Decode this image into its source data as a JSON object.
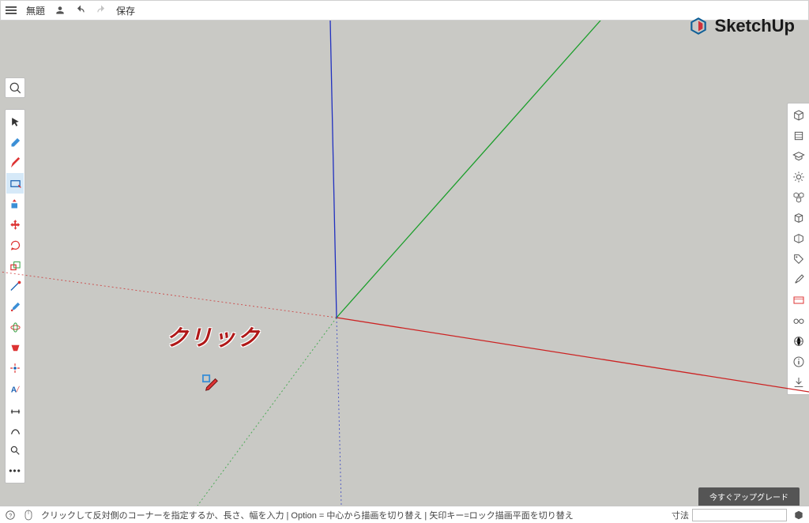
{
  "topbar": {
    "title": "無題",
    "save": "保存"
  },
  "logo": {
    "text": "SketchUp"
  },
  "annotation": {
    "label": "クリック"
  },
  "statusbar": {
    "hint": "クリックして反対側のコーナーを指定するか、長さ、幅を入力 | Option = 中心から描画を切り替え | 矢印キー=ロック描画平面を切り替え",
    "dim_label": "寸法"
  },
  "upgrade": {
    "label": "今すぐアップグレード"
  },
  "left_tools": [
    {
      "name": "select-tool",
      "active": false
    },
    {
      "name": "eraser-tool",
      "active": false
    },
    {
      "name": "pencil-tool",
      "active": false
    },
    {
      "name": "rectangle-tool",
      "active": true
    },
    {
      "name": "pushpull-tool",
      "active": false
    },
    {
      "name": "move-tool",
      "active": false
    },
    {
      "name": "rotate-tool",
      "active": false
    },
    {
      "name": "scale-tool",
      "active": false
    },
    {
      "name": "tape-tool",
      "active": false
    },
    {
      "name": "paint-tool",
      "active": false
    },
    {
      "name": "orbit-tool",
      "active": false
    },
    {
      "name": "section-tool",
      "active": false
    },
    {
      "name": "camera-tool",
      "active": false
    },
    {
      "name": "3dtext-tool",
      "active": false
    },
    {
      "name": "dimension-tool",
      "active": false
    },
    {
      "name": "walk-tool",
      "active": false
    },
    {
      "name": "zoom-tool",
      "active": false
    },
    {
      "name": "more-tool",
      "active": false
    }
  ],
  "right_panels": [
    {
      "name": "entity-info-panel"
    },
    {
      "name": "instructor-panel"
    },
    {
      "name": "learn-panel"
    },
    {
      "name": "components-panel"
    },
    {
      "name": "materials-panel"
    },
    {
      "name": "outliner-panel"
    },
    {
      "name": "tags2-panel"
    },
    {
      "name": "tags-panel"
    },
    {
      "name": "styles-panel"
    },
    {
      "name": "scenes-panel"
    },
    {
      "name": "display-panel"
    },
    {
      "name": "shadows-panel"
    },
    {
      "name": "info-panel"
    },
    {
      "name": "export-panel"
    }
  ]
}
